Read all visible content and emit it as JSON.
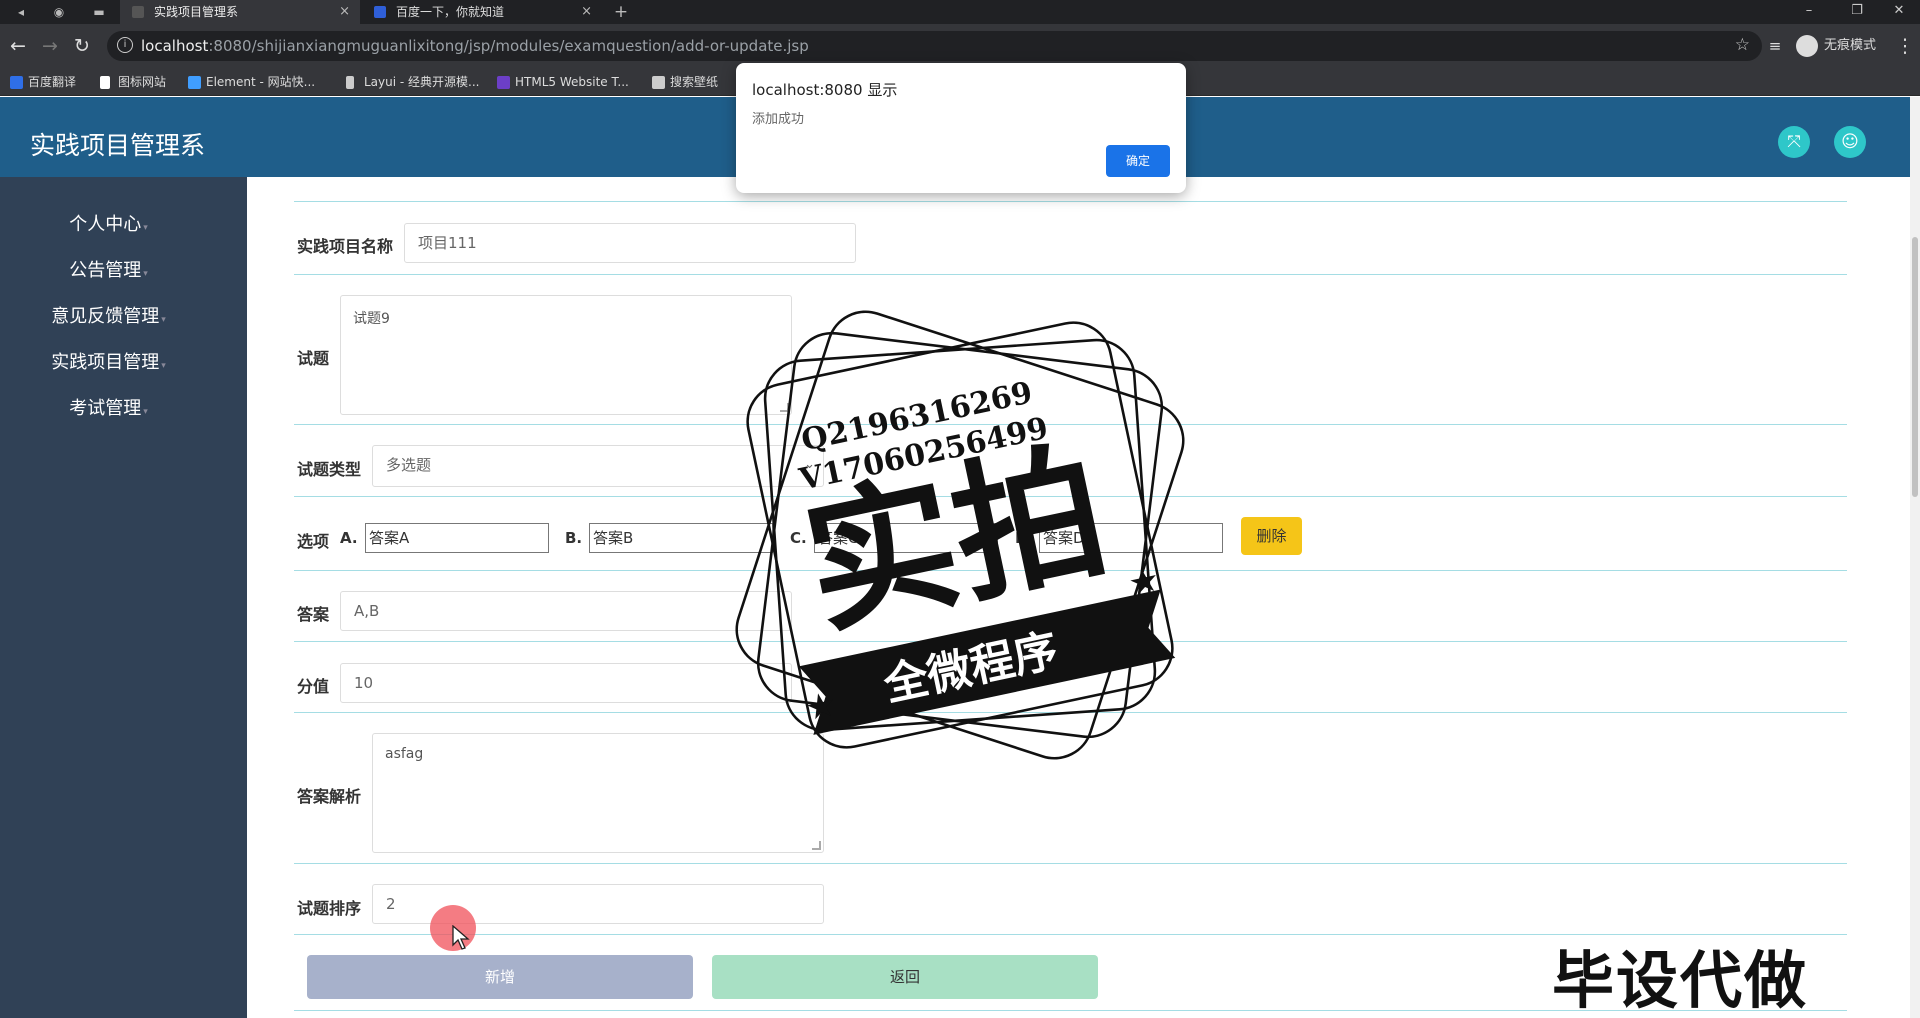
{
  "browser": {
    "tabs": [
      {
        "title": "实践项目管理系",
        "active": true
      },
      {
        "title": "百度一下，你就知道",
        "active": false
      }
    ],
    "close_glyph": "×",
    "new_tab_glyph": "+",
    "url_host": "localhost",
    "url_rest": ":8080/shijianxiangmuguanlixitong/jsp/modules/examquestion/add-or-update.jsp",
    "incognito_label": "无痕模式",
    "bookmarks": [
      {
        "label": "百度翻译",
        "color": "#2f6fe8"
      },
      {
        "label": "图标网站",
        "color": "#ffffff"
      },
      {
        "label": "Element - 网站快...",
        "color": "#409eff"
      },
      {
        "label": "Layui - 经典开源模...",
        "color": "#ffffff"
      },
      {
        "label": "HTML5 Website T...",
        "color": "#6c3fc7"
      },
      {
        "label": "搜索壁纸",
        "color": "#ffffff"
      }
    ]
  },
  "app": {
    "title": "实践项目管理系",
    "header_color": "#1f5e8a",
    "sidebar_color": "#304156",
    "accent_icon_color": "#2ec7c9",
    "header_icons": [
      "fullscreen-icon",
      "user-icon"
    ],
    "sidebar": {
      "items": [
        {
          "label": "个人中心"
        },
        {
          "label": "公告管理"
        },
        {
          "label": "意见反馈管理"
        },
        {
          "label": "实践项目管理"
        },
        {
          "label": "考试管理"
        }
      ]
    },
    "form": {
      "project_name": {
        "label": "实践项目名称",
        "value": "项目111"
      },
      "question": {
        "label": "试题",
        "value": "试题9"
      },
      "question_type": {
        "label": "试题类型",
        "value": "多选题"
      },
      "options": {
        "label": "选项",
        "items": [
          {
            "letter": "A.",
            "value": "答案A"
          },
          {
            "letter": "B.",
            "value": "答案B"
          },
          {
            "letter": "C.",
            "value": "答案C"
          },
          {
            "letter": "D.",
            "value": "答案D"
          }
        ],
        "delete_label": "删除"
      },
      "answer": {
        "label": "答案",
        "value": "A,B"
      },
      "score": {
        "label": "分值",
        "value": "10"
      },
      "analysis": {
        "label": "答案解析",
        "value": "asfag"
      },
      "order": {
        "label": "试题排序",
        "value": "2"
      },
      "submit_label": "新增",
      "back_label": "返回"
    }
  },
  "alert": {
    "title": "localhost:8080 显示",
    "message": "添加成功",
    "ok_label": "确定"
  },
  "watermark": {
    "line1": "Q2196316269",
    "line2": "V17060256499",
    "main": "实拍",
    "ribbon": "全微程序",
    "corner": "毕设代做"
  }
}
